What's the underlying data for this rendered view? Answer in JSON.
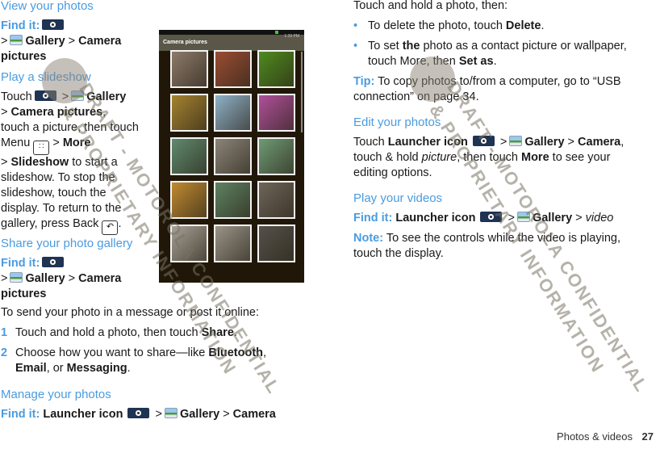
{
  "left": {
    "view_head": "View your photos",
    "find_it": "Find it:",
    "gt": ">",
    "gallery": "Gallery",
    "camera_pictures_a": "Camera",
    "camera_pictures_b": "pictures",
    "slideshow_head": "Play a slideshow",
    "slideshow_lines": {
      "touch": "Touch",
      "camera_pictures": "Camera pictures",
      "comma": ",",
      "l3": "touch a picture, then touch",
      "menu": "Menu",
      "more": "More",
      "slideshow": "Slideshow",
      "l5_rest": " to start a",
      "l6": "slideshow. To stop the",
      "l7": "slideshow, touch the",
      "l8": "display. To return to the",
      "l9": "gallery, press Back",
      "period": "."
    },
    "share_head": "Share your photo gallery",
    "share_intro": "To send your photo in a message or post it online:",
    "steps": [
      {
        "n": "1",
        "pre": "Touch and hold a photo, then touch ",
        "bold": "Share",
        "post": "."
      },
      {
        "n": "2",
        "pre": "Choose how you want to share—like ",
        "bold": "Bluetooth",
        "post": ","
      }
    ],
    "step2_line2": {
      "email": "Email",
      "or": ", or ",
      "messaging": "Messaging",
      "end": "."
    },
    "manage_head": "Manage your photos",
    "launcher_icon": "Launcher icon",
    "camera": "Camera"
  },
  "phone": {
    "title": "Camera pictures",
    "time": "1:39 PM",
    "thumbnails": [
      {
        "subject": "horse",
        "color": "#8d7a6a"
      },
      {
        "subject": "brick-building",
        "color": "#9b4d33"
      },
      {
        "subject": "green-dinosaur",
        "color": "#4f8a1e"
      },
      {
        "subject": "school-bus",
        "color": "#a5822f"
      },
      {
        "subject": "lake",
        "color": "#8fb1c8"
      },
      {
        "subject": "colorful-fabric",
        "color": "#b0509a"
      },
      {
        "subject": "fish",
        "color": "#5f8a6d"
      },
      {
        "subject": "bird-statue",
        "color": "#8c8478"
      },
      {
        "subject": "mosaic-sculpture",
        "color": "#6f9a74"
      },
      {
        "subject": "dinosaur-sign",
        "color": "#c08a30"
      },
      {
        "subject": "polar-bear",
        "color": "#5e8262"
      },
      {
        "subject": "brown-bear",
        "color": "#6f655a"
      },
      {
        "subject": "city-skyline",
        "color": "#a6a096"
      },
      {
        "subject": "museum",
        "color": "#9a9488"
      },
      {
        "subject": "coin",
        "color": "#55514a"
      }
    ]
  },
  "right": {
    "intro": "Touch and hold a photo, then:",
    "bullets": [
      {
        "pre": "To delete the photo, touch ",
        "bold": "Delete",
        "post": "."
      },
      {
        "pre": "To set ",
        "bold": "the",
        "post": " photo as a contact picture or wallpaper,"
      }
    ],
    "bullet2_line2": {
      "pre": "touch More, then ",
      "bold": "Set as",
      "post": "."
    },
    "tip_label": "Tip:",
    "tip_l1": " To copy photos to/from a computer, go to “USB",
    "tip_l2": "connection” on page 34.",
    "edit_head": "Edit your photos",
    "edit": {
      "touch": "Touch ",
      "launcher": "Launcher icon",
      "gallery": "Gallery",
      "camera": "Camera",
      "comma": ",",
      "l2_pre": "touch & hold ",
      "picture": "picture",
      "l2_mid": ", then touch ",
      "more": "More",
      "l2_post": " to see your",
      "l3": "editing options."
    },
    "video_head": "Play your videos",
    "find_it": "Find it:",
    "launcher": "Launcher icon",
    "gallery": "Gallery",
    "video": "video",
    "note_label": "Note:",
    "note_l1": " To see the controls while the video is playing,",
    "note_l2": "touch the display.",
    "gt": ">"
  },
  "footer": {
    "section": "Photos & videos",
    "page": "27"
  },
  "watermark": {
    "line1": "DRAFT - MOTOROLA CONFIDENTIAL",
    "line2": "& PROPRIETARY INFORMATION"
  }
}
